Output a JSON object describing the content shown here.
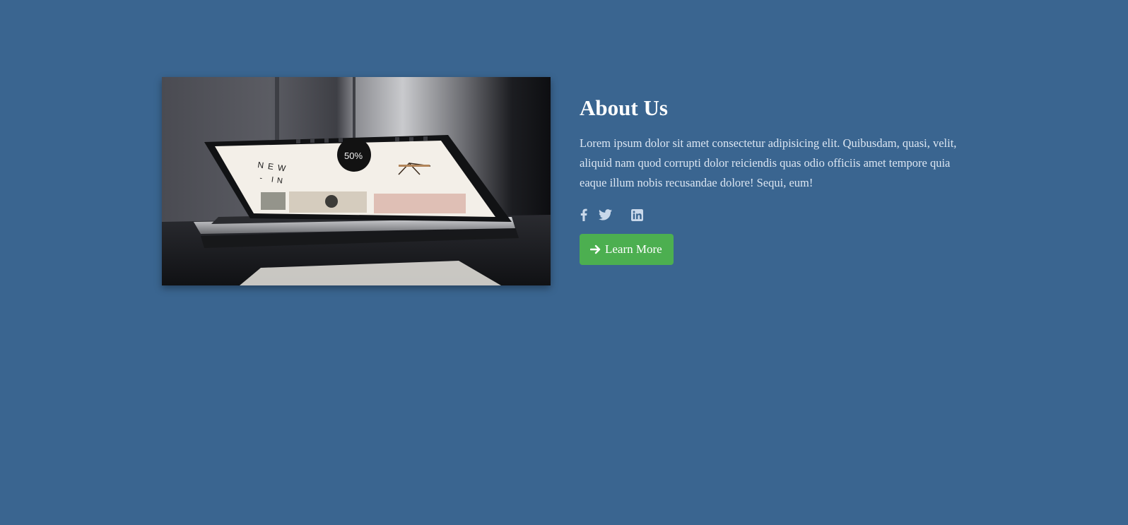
{
  "about": {
    "title": "About Us",
    "description": "Lorem ipsum dolor sit amet consectetur adipisicing elit. Quibusdam, quasi, velit, aliquid nam quod corrupti dolor reiciendis quas odio officiis amet tempore quia eaque illum nobis recusandae dolore! Sequi, eum!",
    "button_label": "Learn More",
    "button_icon": "arrow-right-icon"
  },
  "photo": {
    "screen_text_1": "NEW",
    "screen_text_2": "- IN",
    "badge_text": "50%"
  },
  "social": [
    {
      "name": "facebook-icon"
    },
    {
      "name": "twitter-icon"
    },
    {
      "name": "linkedin-icon"
    }
  ],
  "colors": {
    "background": "#3a6590",
    "button": "#4caf50",
    "heading": "#ffffff",
    "body_text": "#dce6f2",
    "icons": "#c9d8ea"
  }
}
